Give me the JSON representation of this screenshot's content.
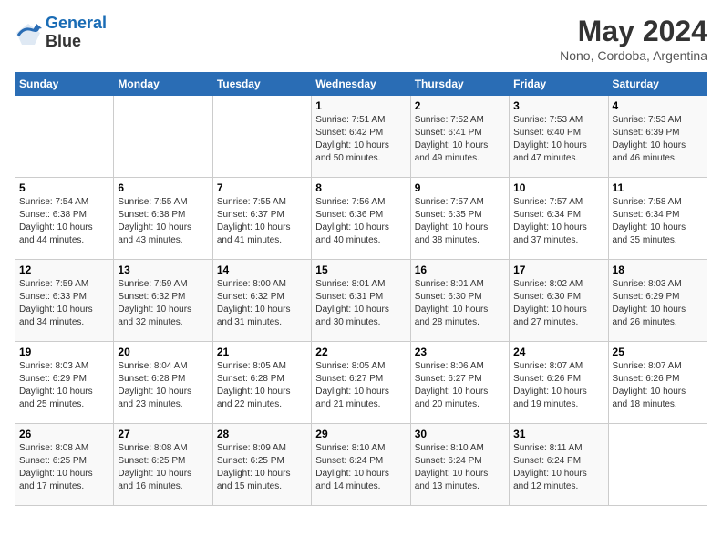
{
  "logo": {
    "line1": "General",
    "line2": "Blue"
  },
  "title": "May 2024",
  "subtitle": "Nono, Cordoba, Argentina",
  "days_of_week": [
    "Sunday",
    "Monday",
    "Tuesday",
    "Wednesday",
    "Thursday",
    "Friday",
    "Saturday"
  ],
  "weeks": [
    [
      {
        "day": "",
        "info": ""
      },
      {
        "day": "",
        "info": ""
      },
      {
        "day": "",
        "info": ""
      },
      {
        "day": "1",
        "info": "Sunrise: 7:51 AM\nSunset: 6:42 PM\nDaylight: 10 hours\nand 50 minutes."
      },
      {
        "day": "2",
        "info": "Sunrise: 7:52 AM\nSunset: 6:41 PM\nDaylight: 10 hours\nand 49 minutes."
      },
      {
        "day": "3",
        "info": "Sunrise: 7:53 AM\nSunset: 6:40 PM\nDaylight: 10 hours\nand 47 minutes."
      },
      {
        "day": "4",
        "info": "Sunrise: 7:53 AM\nSunset: 6:39 PM\nDaylight: 10 hours\nand 46 minutes."
      }
    ],
    [
      {
        "day": "5",
        "info": "Sunrise: 7:54 AM\nSunset: 6:38 PM\nDaylight: 10 hours\nand 44 minutes."
      },
      {
        "day": "6",
        "info": "Sunrise: 7:55 AM\nSunset: 6:38 PM\nDaylight: 10 hours\nand 43 minutes."
      },
      {
        "day": "7",
        "info": "Sunrise: 7:55 AM\nSunset: 6:37 PM\nDaylight: 10 hours\nand 41 minutes."
      },
      {
        "day": "8",
        "info": "Sunrise: 7:56 AM\nSunset: 6:36 PM\nDaylight: 10 hours\nand 40 minutes."
      },
      {
        "day": "9",
        "info": "Sunrise: 7:57 AM\nSunset: 6:35 PM\nDaylight: 10 hours\nand 38 minutes."
      },
      {
        "day": "10",
        "info": "Sunrise: 7:57 AM\nSunset: 6:34 PM\nDaylight: 10 hours\nand 37 minutes."
      },
      {
        "day": "11",
        "info": "Sunrise: 7:58 AM\nSunset: 6:34 PM\nDaylight: 10 hours\nand 35 minutes."
      }
    ],
    [
      {
        "day": "12",
        "info": "Sunrise: 7:59 AM\nSunset: 6:33 PM\nDaylight: 10 hours\nand 34 minutes."
      },
      {
        "day": "13",
        "info": "Sunrise: 7:59 AM\nSunset: 6:32 PM\nDaylight: 10 hours\nand 32 minutes."
      },
      {
        "day": "14",
        "info": "Sunrise: 8:00 AM\nSunset: 6:32 PM\nDaylight: 10 hours\nand 31 minutes."
      },
      {
        "day": "15",
        "info": "Sunrise: 8:01 AM\nSunset: 6:31 PM\nDaylight: 10 hours\nand 30 minutes."
      },
      {
        "day": "16",
        "info": "Sunrise: 8:01 AM\nSunset: 6:30 PM\nDaylight: 10 hours\nand 28 minutes."
      },
      {
        "day": "17",
        "info": "Sunrise: 8:02 AM\nSunset: 6:30 PM\nDaylight: 10 hours\nand 27 minutes."
      },
      {
        "day": "18",
        "info": "Sunrise: 8:03 AM\nSunset: 6:29 PM\nDaylight: 10 hours\nand 26 minutes."
      }
    ],
    [
      {
        "day": "19",
        "info": "Sunrise: 8:03 AM\nSunset: 6:29 PM\nDaylight: 10 hours\nand 25 minutes."
      },
      {
        "day": "20",
        "info": "Sunrise: 8:04 AM\nSunset: 6:28 PM\nDaylight: 10 hours\nand 23 minutes."
      },
      {
        "day": "21",
        "info": "Sunrise: 8:05 AM\nSunset: 6:28 PM\nDaylight: 10 hours\nand 22 minutes."
      },
      {
        "day": "22",
        "info": "Sunrise: 8:05 AM\nSunset: 6:27 PM\nDaylight: 10 hours\nand 21 minutes."
      },
      {
        "day": "23",
        "info": "Sunrise: 8:06 AM\nSunset: 6:27 PM\nDaylight: 10 hours\nand 20 minutes."
      },
      {
        "day": "24",
        "info": "Sunrise: 8:07 AM\nSunset: 6:26 PM\nDaylight: 10 hours\nand 19 minutes."
      },
      {
        "day": "25",
        "info": "Sunrise: 8:07 AM\nSunset: 6:26 PM\nDaylight: 10 hours\nand 18 minutes."
      }
    ],
    [
      {
        "day": "26",
        "info": "Sunrise: 8:08 AM\nSunset: 6:25 PM\nDaylight: 10 hours\nand 17 minutes."
      },
      {
        "day": "27",
        "info": "Sunrise: 8:08 AM\nSunset: 6:25 PM\nDaylight: 10 hours\nand 16 minutes."
      },
      {
        "day": "28",
        "info": "Sunrise: 8:09 AM\nSunset: 6:25 PM\nDaylight: 10 hours\nand 15 minutes."
      },
      {
        "day": "29",
        "info": "Sunrise: 8:10 AM\nSunset: 6:24 PM\nDaylight: 10 hours\nand 14 minutes."
      },
      {
        "day": "30",
        "info": "Sunrise: 8:10 AM\nSunset: 6:24 PM\nDaylight: 10 hours\nand 13 minutes."
      },
      {
        "day": "31",
        "info": "Sunrise: 8:11 AM\nSunset: 6:24 PM\nDaylight: 10 hours\nand 12 minutes."
      },
      {
        "day": "",
        "info": ""
      }
    ]
  ]
}
